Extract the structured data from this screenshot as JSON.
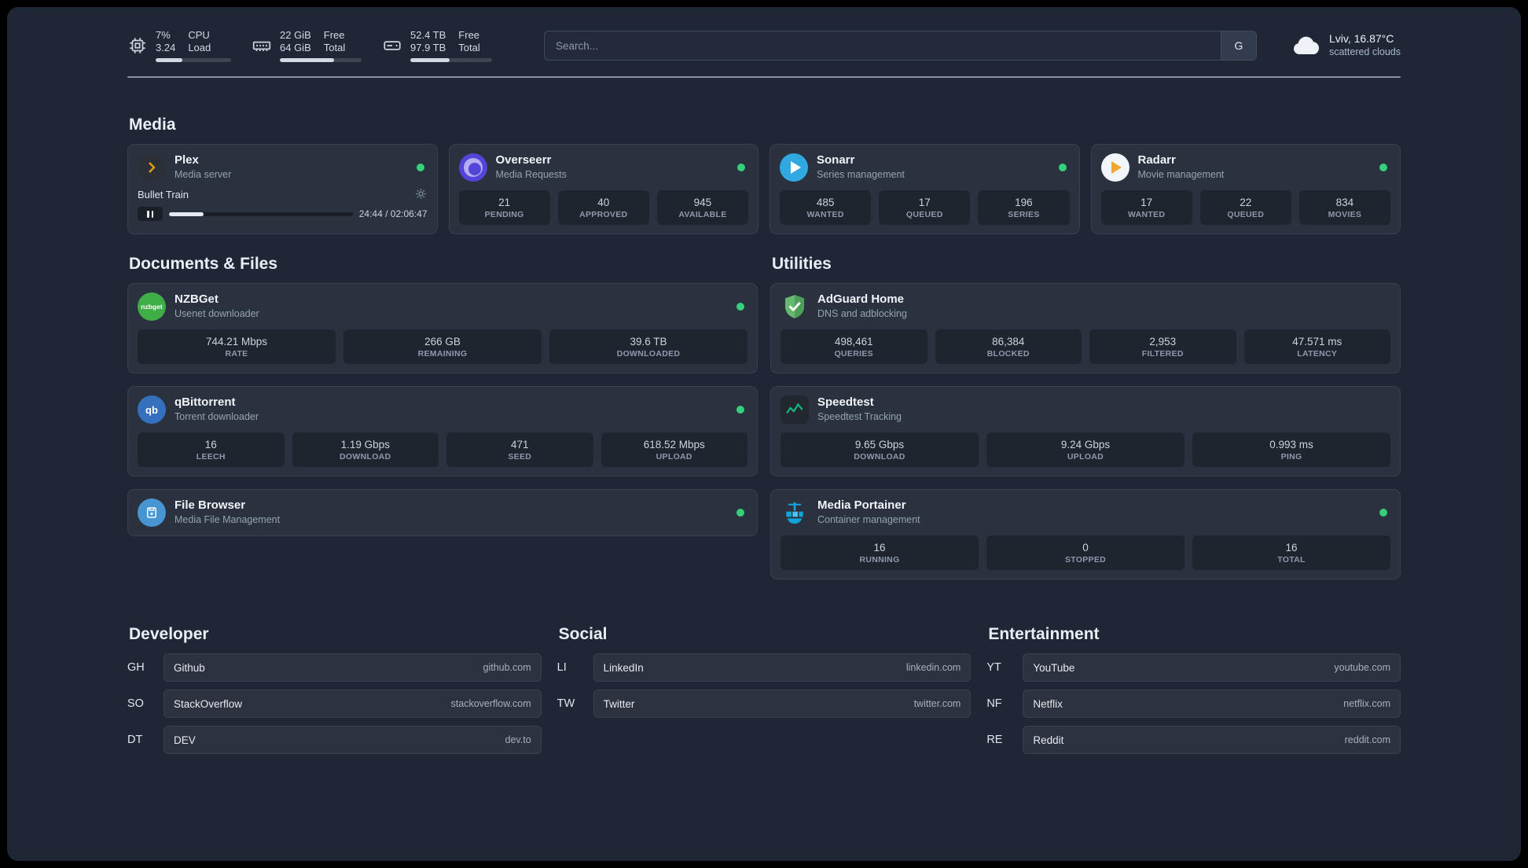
{
  "topbar": {
    "cpu": {
      "top_value": "7%",
      "bottom_value": "3.24",
      "top_label": "CPU",
      "bottom_label": "Load",
      "progress_pct": 35
    },
    "memory": {
      "top_value": "22 GiB",
      "bottom_value": "64 GiB",
      "top_label": "Free",
      "bottom_label": "Total",
      "progress_pct": 66
    },
    "disk": {
      "top_value": "52.4 TB",
      "bottom_value": "97.9 TB",
      "top_label": "Free",
      "bottom_label": "Total",
      "progress_pct": 48
    },
    "search": {
      "placeholder": "Search...",
      "provider_label": "G"
    },
    "weather": {
      "location": "Lviv, 16.87°C",
      "condition": "scattered clouds"
    }
  },
  "media": {
    "heading": "Media",
    "plex": {
      "title": "Plex",
      "subtitle": "Media server",
      "player": {
        "track": "Bullet Train",
        "time": "24:44 / 02:06:47",
        "progress_pct": 19
      }
    },
    "overseerr": {
      "title": "Overseerr",
      "subtitle": "Media Requests",
      "stats": [
        {
          "value": "21",
          "label": "PENDING"
        },
        {
          "value": "40",
          "label": "APPROVED"
        },
        {
          "value": "945",
          "label": "AVAILABLE"
        }
      ]
    },
    "sonarr": {
      "title": "Sonarr",
      "subtitle": "Series management",
      "stats": [
        {
          "value": "485",
          "label": "WANTED"
        },
        {
          "value": "17",
          "label": "QUEUED"
        },
        {
          "value": "196",
          "label": "SERIES"
        }
      ]
    },
    "radarr": {
      "title": "Radarr",
      "subtitle": "Movie management",
      "stats": [
        {
          "value": "17",
          "label": "WANTED"
        },
        {
          "value": "22",
          "label": "QUEUED"
        },
        {
          "value": "834",
          "label": "MOVIES"
        }
      ]
    }
  },
  "documents": {
    "heading": "Documents & Files",
    "nzbget": {
      "title": "NZBGet",
      "subtitle": "Usenet downloader",
      "icon_text": "nzbget",
      "stats": [
        {
          "value": "744.21 Mbps",
          "label": "RATE"
        },
        {
          "value": "266 GB",
          "label": "REMAINING"
        },
        {
          "value": "39.6 TB",
          "label": "DOWNLOADED"
        }
      ]
    },
    "qbittorrent": {
      "title": "qBittorrent",
      "subtitle": "Torrent downloader",
      "icon_text": "qb",
      "stats": [
        {
          "value": "16",
          "label": "LEECH"
        },
        {
          "value": "1.19 Gbps",
          "label": "DOWNLOAD"
        },
        {
          "value": "471",
          "label": "SEED"
        },
        {
          "value": "618.52 Mbps",
          "label": "UPLOAD"
        }
      ]
    },
    "filebrowser": {
      "title": "File Browser",
      "subtitle": "Media File Management"
    }
  },
  "utilities": {
    "heading": "Utilities",
    "adguard": {
      "title": "AdGuard Home",
      "subtitle": "DNS and adblocking",
      "stats": [
        {
          "value": "498,461",
          "label": "QUERIES"
        },
        {
          "value": "86,384",
          "label": "BLOCKED"
        },
        {
          "value": "2,953",
          "label": "FILTERED"
        },
        {
          "value": "47.571 ms",
          "label": "LATENCY"
        }
      ]
    },
    "speedtest": {
      "title": "Speedtest",
      "subtitle": "Speedtest Tracking",
      "stats": [
        {
          "value": "9.65 Gbps",
          "label": "DOWNLOAD"
        },
        {
          "value": "9.24 Gbps",
          "label": "UPLOAD"
        },
        {
          "value": "0.993 ms",
          "label": "PING"
        }
      ]
    },
    "portainer": {
      "title": "Media Portainer",
      "subtitle": "Container management",
      "stats": [
        {
          "value": "16",
          "label": "RUNNING"
        },
        {
          "value": "0",
          "label": "STOPPED"
        },
        {
          "value": "16",
          "label": "TOTAL"
        }
      ]
    }
  },
  "bookmarks": {
    "developer": {
      "heading": "Developer",
      "items": [
        {
          "abbr": "GH",
          "name": "Github",
          "url": "github.com"
        },
        {
          "abbr": "SO",
          "name": "StackOverflow",
          "url": "stackoverflow.com"
        },
        {
          "abbr": "DT",
          "name": "DEV",
          "url": "dev.to"
        }
      ]
    },
    "social": {
      "heading": "Social",
      "items": [
        {
          "abbr": "LI",
          "name": "LinkedIn",
          "url": "linkedin.com"
        },
        {
          "abbr": "TW",
          "name": "Twitter",
          "url": "twitter.com"
        }
      ]
    },
    "entertainment": {
      "heading": "Entertainment",
      "items": [
        {
          "abbr": "YT",
          "name": "YouTube",
          "url": "youtube.com"
        },
        {
          "abbr": "NF",
          "name": "Netflix",
          "url": "netflix.com"
        },
        {
          "abbr": "RE",
          "name": "Reddit",
          "url": "reddit.com"
        }
      ]
    }
  },
  "colors": {
    "status_online": "#35d07a",
    "background": "#1f2635",
    "plex_amber": "#e5a00d",
    "adguard_green": "#67b871",
    "portainer_blue": "#12a3d8"
  }
}
